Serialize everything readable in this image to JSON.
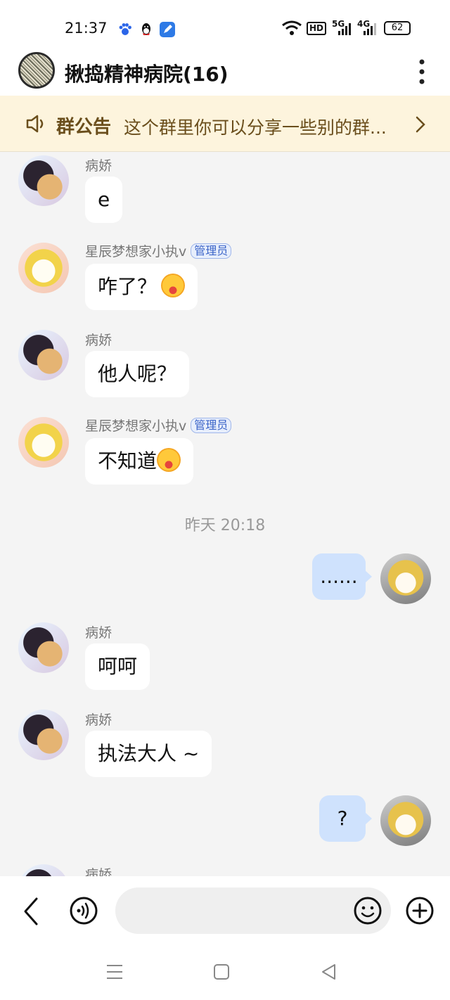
{
  "status_bar": {
    "time": "21:37",
    "app_icons": [
      "baidu-icon",
      "qq-icon",
      "edit-app-icon"
    ],
    "network": [
      "wifi-icon",
      "HD",
      "5G",
      "4G"
    ],
    "battery": "62"
  },
  "header": {
    "title": "揪捣精神病院(16)",
    "more_icon": "vertical-dots-icon"
  },
  "announcement": {
    "title": "群公告",
    "text": "这个群里你可以分享一些别的群..."
  },
  "messages": [
    {
      "type": "incoming",
      "sender": "病娇",
      "text": "e"
    },
    {
      "type": "incoming",
      "sender": "星辰梦想家小执v",
      "badge": "管理员",
      "text": "咋了？",
      "emoji": "drooling-face-emoji"
    },
    {
      "type": "incoming",
      "sender": "病娇",
      "text": "他人呢？"
    },
    {
      "type": "incoming",
      "sender": "星辰梦想家小执v",
      "badge": "管理员",
      "text": "不知道",
      "emoji": "drooling-face-emoji"
    },
    {
      "type": "timestamp",
      "text": "昨天 20:18"
    },
    {
      "type": "outgoing",
      "text": "......"
    },
    {
      "type": "incoming",
      "sender": "病娇",
      "text": "呵呵"
    },
    {
      "type": "incoming",
      "sender": "病娇",
      "text": "执法大人 ~"
    },
    {
      "type": "outgoing",
      "text": "?"
    },
    {
      "type": "incoming",
      "sender": "病娇",
      "text": ""
    }
  ],
  "input_bar": {
    "placeholder": "",
    "icons": [
      "back-icon",
      "voice-icon",
      "emoji-icon",
      "plus-icon"
    ]
  },
  "nav_bar": {
    "icons": [
      "menu-icon",
      "home-icon",
      "back-triangle-icon"
    ]
  },
  "colors": {
    "notice_bg": "#fdf4dd",
    "notice_text": "#6a4e1c",
    "outgoing_bubble": "#cfe2fd",
    "admin_badge": "#3b64c8"
  }
}
